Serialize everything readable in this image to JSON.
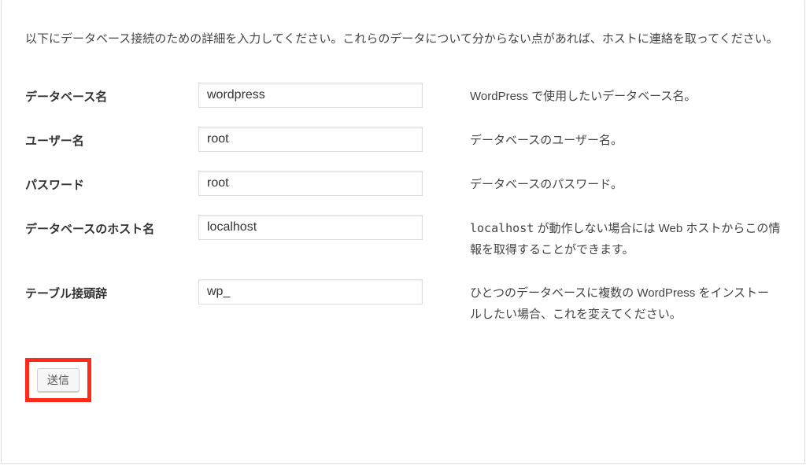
{
  "intro": "以下にデータベース接続のための詳細を入力してください。これらのデータについて分からない点があれば、ホストに連絡を取ってください。",
  "fields": {
    "dbname": {
      "label": "データベース名",
      "value": "wordpress",
      "desc": "WordPress で使用したいデータベース名。"
    },
    "username": {
      "label": "ユーザー名",
      "value": "root",
      "desc": "データベースのユーザー名。"
    },
    "password": {
      "label": "パスワード",
      "value": "root",
      "desc": "データベースのパスワード。"
    },
    "host": {
      "label": "データベースのホスト名",
      "value": "localhost",
      "desc_pre": "localhost",
      "desc_post": " が動作しない場合には Web ホストからこの情報を取得することができます。"
    },
    "prefix": {
      "label": "テーブル接頭辞",
      "value": "wp_",
      "desc": "ひとつのデータベースに複数の WordPress をインストールしたい場合、これを変えてください。"
    }
  },
  "submit_label": "送信"
}
